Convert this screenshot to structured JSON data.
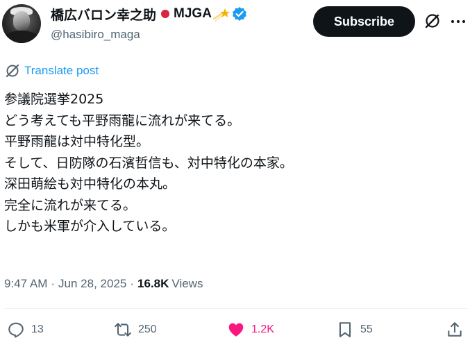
{
  "author": {
    "display_name": "橋広バロン幸之助",
    "name_suffix": "MJGA",
    "flag_icon": "japan-flag-emoji",
    "comet_icon": "dizzy-star-emoji",
    "verified_icon": "verified-badge",
    "handle": "@hasibiro_maga"
  },
  "header": {
    "subscribe_label": "Subscribe",
    "grok_icon": "grok-icon",
    "more_icon": "more-horizontal-icon"
  },
  "translate": {
    "icon": "translate-icon",
    "label": "Translate post"
  },
  "post": {
    "lines": [
      "参議院選挙2025",
      "どう考えても平野雨龍に流れが来てる。",
      "平野雨龍は対中特化型。",
      "そして、日防隊の石濱哲信も、対中特化の本家。",
      "深田萌絵も対中特化の本丸。",
      "完全に流れが来てる。",
      "しかも米軍が介入している。"
    ]
  },
  "meta": {
    "time": "9:47 AM",
    "date": "Jun 28, 2025",
    "separator": "·",
    "views_count": "16.8K",
    "views_label": "Views"
  },
  "actions": {
    "reply_count": "13",
    "repost_count": "250",
    "like_count": "1.2K",
    "bookmark_count": "55"
  },
  "colors": {
    "text": "#0f1419",
    "secondary": "#536471",
    "accent": "#1d9bf0",
    "like": "#f91880",
    "verified": "#1d9bf0",
    "subscribe_bg": "#0f1419"
  }
}
